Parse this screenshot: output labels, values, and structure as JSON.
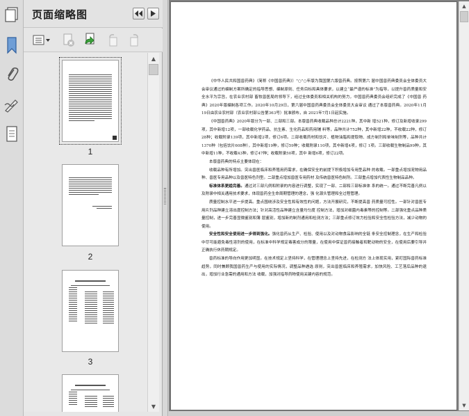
{
  "panel": {
    "title": "页面缩略图",
    "thumbnails": [
      {
        "page": "1",
        "selected": true
      },
      {
        "page": "2",
        "selected": false
      },
      {
        "page": "3",
        "selected": false
      }
    ]
  },
  "rail_icons": [
    "pages-icon",
    "bookmark-icon",
    "attachment-icon",
    "signature-icon",
    "layers-icon"
  ],
  "document": {
    "paragraphs": [
      "《中华人民共和国兽药典》（简称《中国兽药典》）\"○\"○年版为我国第六版兽药典。按照第六 届中国兽药典委员会全体委员大会审议通过的编制方案所确定的指导思想、编制原则、任务目标和具体要求，以建立“最严谨的标准”为指导，以提升兽药质量和安全水平为宗旨，在农业农村部 畜牧兽医局的领导下，经过全体委员和相关机构的努力，中国兽药典委员会组织完成了《中国兽 药典》2020年版编制各项工作。2020年10月29日，第六届中国兽药典委员会全体委员大会审议 通过了本版兽药典。2020年11月19日由农业农村部（农业农村部公告第363号）批准颁布，自 2021年7月1日起实施。",
      "《中国兽药典》2020年版分为一部、二部和三部。本版兽药典收载品种总计2221种，其中新 增521种，修订及新增收录299项，其中新增12项，一部收载化学药品、抗生素、生化药品和药用辅 料等，品种共计752种，其中新增22种，不收载22种，修订28种；收载附录139项，其中新增2项，修订6项。二部收载药材和饮片、植物油脂和提取物、成方制剂和单味制剂等，品种共计 1370种（包括饮片608种），其中新增19种，修订59种；收载附录110项，其中新增4项，修订 1项。三部收载生物制品99种，其中新增11种，不收载43种，修订47种；收载附录50项，其中 新增6项，修订22项。",
      "本版兽药典的特点主要体现在：",
      "收载品种有所增加。突出兽医临床和养殖用药需求，在确保安全的前提下积极增加专用型品种 的收载。一部重点增加宠物用品种、兽医专用品种以及兽医特色剂型。二部重点增加兽医专用药材 及传统兽医特色制剂。三部重点增加代表性生物制品品种。",
      "标准体系更趋完善。通过对三部凡例和附录的内容进行调整，实现了一部、二部和三部标准体 系的统一。通过不断完善凡例以及附录中相关通用技术要求，体现兽药全生命周期管理的理念，强 化源头管理和全过程管理。",
      "质量控制水平进一步提高。重点围绕涉及安全性和有效性的问题，方法开展研究，不断提高兽 药质量可控性。一部针对兽医专用片剂品种建立溶出度控制方法；针对高活性品种建立含量均匀度 控制方法，增加对细菌内毒素等的控制等。二部强化重点品种质量控制，进一步完善显微鉴别和薄 层鉴别，增加新的制剂通用和检测方法；三部重点修订效力检验和安全性检验方法，减少动物的 使用。",
      "安全性和安全使用进一步得到强化。强化兽药从生产、检验、使用以及对动物食品影响的全链 条安全控制理念，在生产和检验中尽可能避免毒性溶剂的使用，在标准中科学规定毒害成分的限量，在使用中保证兽药接触者和靶动物的安全，在使用后要引导并正确执行休药期规定。",
      "兽药标准的导向作用更加明显。在技术规定上坚持科学，在管理理念上坚持先进，在检测方 法上体现实用，紧盯国际兽药标准趋势，同时兼顾我国兽药生产与使用的实际情况，调整品种遴选 原则，突出兽医临床和养殖需求，加快风险、工艺落后品种的退出，增加行业急需的通用和方法 收载，加强对指导药物使用关键内容的规范。"
    ],
    "bold_leads": [
      "",
      "",
      "",
      "",
      "标准体系更趋完善。",
      "",
      "安全性和安全使用进一步得到强化。",
      ""
    ]
  }
}
